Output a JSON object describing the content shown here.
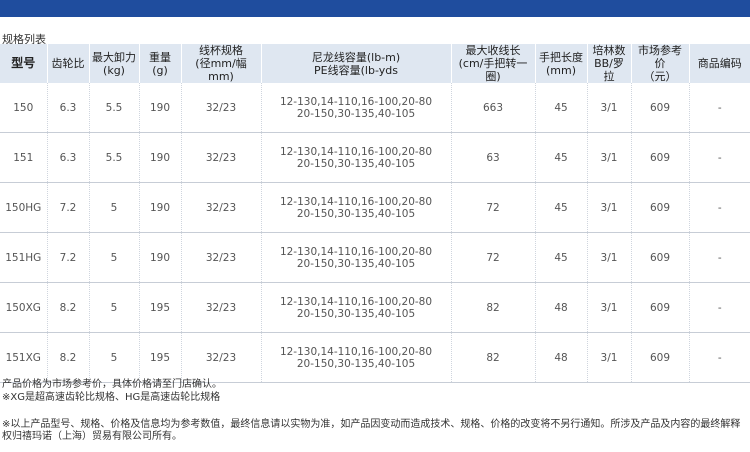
{
  "section_title": "规格列表",
  "columns": [
    {
      "l1": "型号",
      "l2": ""
    },
    {
      "l1": "齿轮比",
      "l2": ""
    },
    {
      "l1": "最大卸力",
      "l2": "(kg)"
    },
    {
      "l1": "重量(g)",
      "l2": ""
    },
    {
      "l1": "线杯规格",
      "l2": "(径mm/幅mm)"
    },
    {
      "l1": "尼龙线容量(lb-m)",
      "l2": "PE线容量(lb-yds"
    },
    {
      "l1": "最大收线长",
      "l2": "(cm/手把转一圈)"
    },
    {
      "l1": "手把长度",
      "l2": "(mm)"
    },
    {
      "l1": "培林数",
      "l2": "BB/罗拉"
    },
    {
      "l1": "市场参考价",
      "l2": "（元）"
    },
    {
      "l1": "商品编码",
      "l2": ""
    }
  ],
  "rows": [
    {
      "model": "150",
      "ratio": "6.3",
      "drag": "5.5",
      "weight": "190",
      "spool": "32/23",
      "cap1": "12-130,14-110,16-100,20-80",
      "cap2": "20-150,30-135,40-105",
      "retrieve": "663",
      "handle": "45",
      "bearings": "3/1",
      "price": "609",
      "code": "-"
    },
    {
      "model": "151",
      "ratio": "6.3",
      "drag": "5.5",
      "weight": "190",
      "spool": "32/23",
      "cap1": "12-130,14-110,16-100,20-80",
      "cap2": "20-150,30-135,40-105",
      "retrieve": "63",
      "handle": "45",
      "bearings": "3/1",
      "price": "609",
      "code": "-"
    },
    {
      "model": "150HG",
      "ratio": "7.2",
      "drag": "5",
      "weight": "190",
      "spool": "32/23",
      "cap1": "12-130,14-110,16-100,20-80",
      "cap2": "20-150,30-135,40-105",
      "retrieve": "72",
      "handle": "45",
      "bearings": "3/1",
      "price": "609",
      "code": "-"
    },
    {
      "model": "151HG",
      "ratio": "7.2",
      "drag": "5",
      "weight": "190",
      "spool": "32/23",
      "cap1": "12-130,14-110,16-100,20-80",
      "cap2": "20-150,30-135,40-105",
      "retrieve": "72",
      "handle": "45",
      "bearings": "3/1",
      "price": "609",
      "code": "-"
    },
    {
      "model": "150XG",
      "ratio": "8.2",
      "drag": "5",
      "weight": "195",
      "spool": "32/23",
      "cap1": "12-130,14-110,16-100,20-80",
      "cap2": "20-150,30-135,40-105",
      "retrieve": "82",
      "handle": "48",
      "bearings": "3/1",
      "price": "609",
      "code": "-"
    },
    {
      "model": "151XG",
      "ratio": "8.2",
      "drag": "5",
      "weight": "195",
      "spool": "32/23",
      "cap1": "12-130,14-110,16-100,20-80",
      "cap2": "20-150,30-135,40-105",
      "retrieve": "82",
      "handle": "48",
      "bearings": "3/1",
      "price": "609",
      "code": "-"
    }
  ],
  "footer": {
    "note1": "产品价格为市场参考价，具体价格请至门店确认。",
    "note2": "※XG是超高速齿轮比规格、HG是高速齿轮比规格",
    "note3": "※以上产品型号、规格、价格及信息均为参考数值，最终信息请以实物为准，如产品因变动而造成技术、规格、价格的改变将不另行通知。所涉及产品及内容的最终解释权归禧玛诺（上海）贸易有限公司所有。"
  },
  "colors": {
    "top_bar": "#1f4d9e",
    "header_bg": "#dfe7f1",
    "row_border": "#c7cdd6"
  }
}
